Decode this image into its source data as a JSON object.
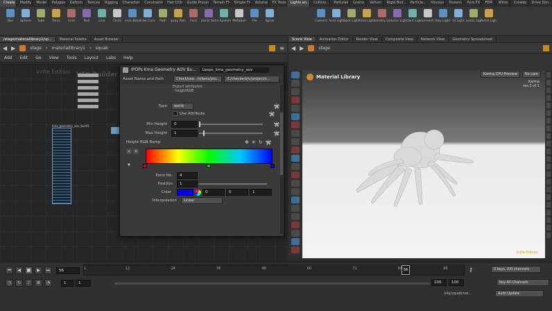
{
  "shelf": {
    "left_tabs": [
      "Create",
      "Modify",
      "Model",
      "Polygon",
      "Deform",
      "Texture",
      "Rigging",
      "Characters",
      "Constraints",
      "Hair Utils",
      "Guide Process",
      "Terrain FX",
      "Simple FX",
      "Volume",
      "FX Tools"
    ],
    "right_tabs": [
      "Lights an...",
      "Collisio...",
      "Particles",
      "Grains",
      "Vellum",
      "Rigid Bod...",
      "Particle...",
      "Viscous",
      "Oceans",
      "Pyro FX",
      "FEM",
      "Wires",
      "Crowds",
      "Drive Sim..."
    ],
    "left_tools": [
      "Box",
      "Sphere",
      "Tube",
      "Torus",
      "Grid",
      "Null",
      "Line",
      "Circle",
      "Curve Bezier",
      "Draw Curve",
      "Path",
      "Spray Paint",
      "Font",
      "Platonic Solids",
      "L-System",
      "Metaball",
      "File",
      "Spiral"
    ],
    "right_tools": [
      "Camera",
      "Point Light",
      "Spot Light",
      "Area Light",
      "Geometry Light",
      "Volume Light",
      "Distant Light",
      "Environment Light",
      "Sky Light",
      "GI Light",
      "Caustic Light",
      "Portal Light"
    ]
  },
  "left_pane": {
    "path_tabs": [
      "/stage/materiallibrary1/sp...",
      "Material Palette",
      "Asset Browser"
    ],
    "nav_obj": "stage",
    "nav_path": "materiallibrary1",
    "nav_leaf": "squab",
    "menu": [
      "Add",
      "Edit",
      "Go",
      "View",
      "Tools",
      "Layout",
      "Labs",
      "Help"
    ],
    "bg_text_1": "Indie Edition",
    "bg_text_2": "VEX Builder",
    "node_label": "kma_geometry_aov_build1"
  },
  "float_panel": {
    "title_type": "IPOPs Kma Geometry AOV Bu...",
    "title_name": "1pops_kma_geometry_aov",
    "asset_name_label": "Asset Name and Path",
    "btn1": "Check/see.../s/kens/pro...",
    "btn2": "/C/checkerb/v/project/s...",
    "info_line1": "Export attributes:",
    "info_line2": "- heightRGB",
    "type_label": "Type",
    "type_value": "world",
    "use_attr_label": "Use Attribute",
    "min_height_label": "Min Height",
    "min_height_value": "0",
    "max_height_label": "Max Height",
    "max_height_value": "1",
    "ramp_label": "Height RGB Ramp",
    "point_no_label": "Point No.",
    "point_no_value": "4",
    "position_label": "Position",
    "position_value": "1",
    "color_label": "Color",
    "color_r": "0",
    "color_g": "0",
    "color_b": "1",
    "interp_label": "Interpolation",
    "interp_value": "Linear"
  },
  "right_pane": {
    "tabs": [
      "Scene View",
      "Animation Editor",
      "Render View",
      "Composite View",
      "Network View",
      "Geometry Spreadsheet"
    ],
    "nav_obj": "stage",
    "viewport_title": "Material Library",
    "render_btn": "Karma CPU Preview",
    "cam_btn": "No cam",
    "hud_line1": "Karma",
    "hud_line2": "res 1 of 1",
    "watermark": "Indie Edition"
  },
  "timeline": {
    "frame": "56",
    "ticks": [
      "1",
      "12",
      "24",
      "36",
      "48",
      "60",
      "72",
      "84",
      "96"
    ],
    "current_marker": "56",
    "start": "1",
    "start2": "1",
    "end": "100",
    "end2": "100",
    "keys_label": "0 keys, 0/0 channels",
    "key_all": "Key All Channels",
    "status_path": "/obj/squab/vel...",
    "auto_update": "Auto Update"
  },
  "colors": {
    "accent": "#f0a000",
    "ramp_red": "#ff0000",
    "ramp_blue": "#0000ff"
  }
}
